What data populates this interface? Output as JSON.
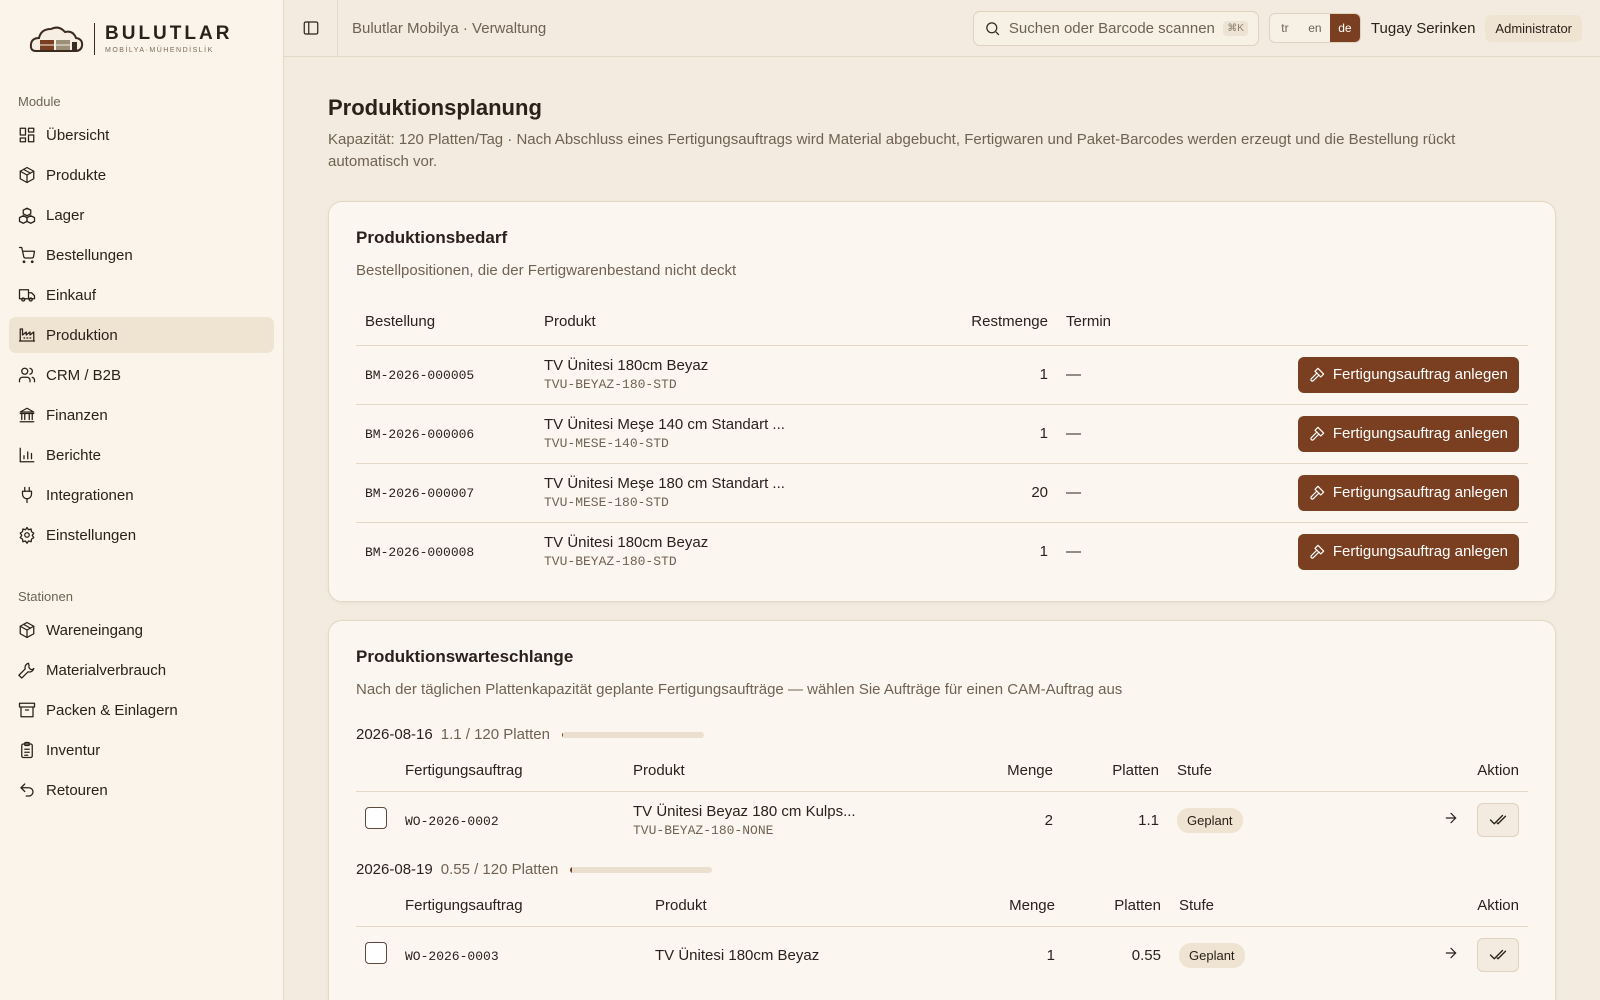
{
  "brand": {
    "name": "BULUTLAR",
    "tagline": "MOBİLYA·MÜHENDİSLİK"
  },
  "sidebar": {
    "section_modules": "Module",
    "modules": [
      {
        "label": "Übersicht",
        "icon": "dashboard-icon"
      },
      {
        "label": "Produkte",
        "icon": "package-icon"
      },
      {
        "label": "Lager",
        "icon": "boxes-icon"
      },
      {
        "label": "Bestellungen",
        "icon": "cart-icon"
      },
      {
        "label": "Einkauf",
        "icon": "truck-icon"
      },
      {
        "label": "Produktion",
        "icon": "factory-icon",
        "active": true
      },
      {
        "label": "CRM / B2B",
        "icon": "users-icon"
      },
      {
        "label": "Finanzen",
        "icon": "bank-icon"
      },
      {
        "label": "Berichte",
        "icon": "chart-icon"
      },
      {
        "label": "Integrationen",
        "icon": "plug-icon"
      },
      {
        "label": "Einstellungen",
        "icon": "gear-icon"
      }
    ],
    "section_stations": "Stationen",
    "stations": [
      {
        "label": "Wareneingang",
        "icon": "package-icon"
      },
      {
        "label": "Materialverbrauch",
        "icon": "wrench-icon"
      },
      {
        "label": "Packen & Einlagern",
        "icon": "archive-icon"
      },
      {
        "label": "Inventur",
        "icon": "clipboard-icon"
      },
      {
        "label": "Retouren",
        "icon": "undo-icon"
      }
    ]
  },
  "topbar": {
    "breadcrumb": "Bulutlar Mobilya · Verwaltung",
    "search_placeholder": "Suchen oder Barcode scannen",
    "search_shortcut": "⌘K",
    "languages": [
      "tr",
      "en",
      "de"
    ],
    "active_language": "de",
    "user_name": "Tugay Serinken",
    "user_role": "Administrator"
  },
  "page": {
    "title": "Produktionsplanung",
    "description": "Kapazität: 120 Platten/Tag · Nach Abschluss eines Fertigungsauftrags wird Material abgebucht, Fertigwaren und Paket-Barcodes werden erzeugt und die Bestellung rückt automatisch vor."
  },
  "demand": {
    "title": "Produktionsbedarf",
    "subtitle": "Bestellpositionen, die der Fertigwarenbestand nicht deckt",
    "columns": {
      "order": "Bestellung",
      "product": "Produkt",
      "remaining": "Restmenge",
      "due": "Termin"
    },
    "action_label": "Fertigungsauftrag anlegen",
    "rows": [
      {
        "order": "BM-2026-000005",
        "product": "TV Ünitesi 180cm Beyaz",
        "sku": "TVU-BEYAZ-180-STD",
        "remaining": "1",
        "due": "—"
      },
      {
        "order": "BM-2026-000006",
        "product": "TV Ünitesi Meşe 140 cm Standart ...",
        "sku": "TVU-MESE-140-STD",
        "remaining": "1",
        "due": "—"
      },
      {
        "order": "BM-2026-000007",
        "product": "TV Ünitesi Meşe 180 cm Standart ...",
        "sku": "TVU-MESE-180-STD",
        "remaining": "20",
        "due": "—"
      },
      {
        "order": "BM-2026-000008",
        "product": "TV Ünitesi 180cm Beyaz",
        "sku": "TVU-BEYAZ-180-STD",
        "remaining": "1",
        "due": "—"
      }
    ]
  },
  "queue": {
    "title": "Produktionswarteschlange",
    "subtitle": "Nach der täglichen Plattenkapazität geplante Fertigungsaufträge — wählen Sie Aufträge für einen CAM-Auftrag aus",
    "columns": {
      "wo": "Fertigungsauftrag",
      "product": "Produkt",
      "qty": "Menge",
      "panels": "Platten",
      "stage": "Stufe",
      "action": "Aktion"
    },
    "days": [
      {
        "date": "2026-08-16",
        "capacity": "1.1 / 120 Platten",
        "utilization": 0.009,
        "rows": [
          {
            "wo": "WO-2026-0002",
            "product": "TV Ünitesi Beyaz 180 cm Kulps...",
            "sku": "TVU-BEYAZ-180-NONE",
            "qty": "2",
            "panels": "1.1",
            "stage": "Geplant"
          }
        ]
      },
      {
        "date": "2026-08-19",
        "capacity": "0.55 / 120 Platten",
        "utilization": 0.005,
        "rows": [
          {
            "wo": "WO-2026-0003",
            "product": "TV Ünitesi 180cm Beyaz",
            "sku": "",
            "qty": "1",
            "panels": "0.55",
            "stage": "Geplant"
          }
        ]
      }
    ]
  },
  "colors": {
    "accent": "#7a3f21",
    "background": "#f3ebdf",
    "sidebar": "#faf4ea",
    "card": "#fbf7f0"
  }
}
